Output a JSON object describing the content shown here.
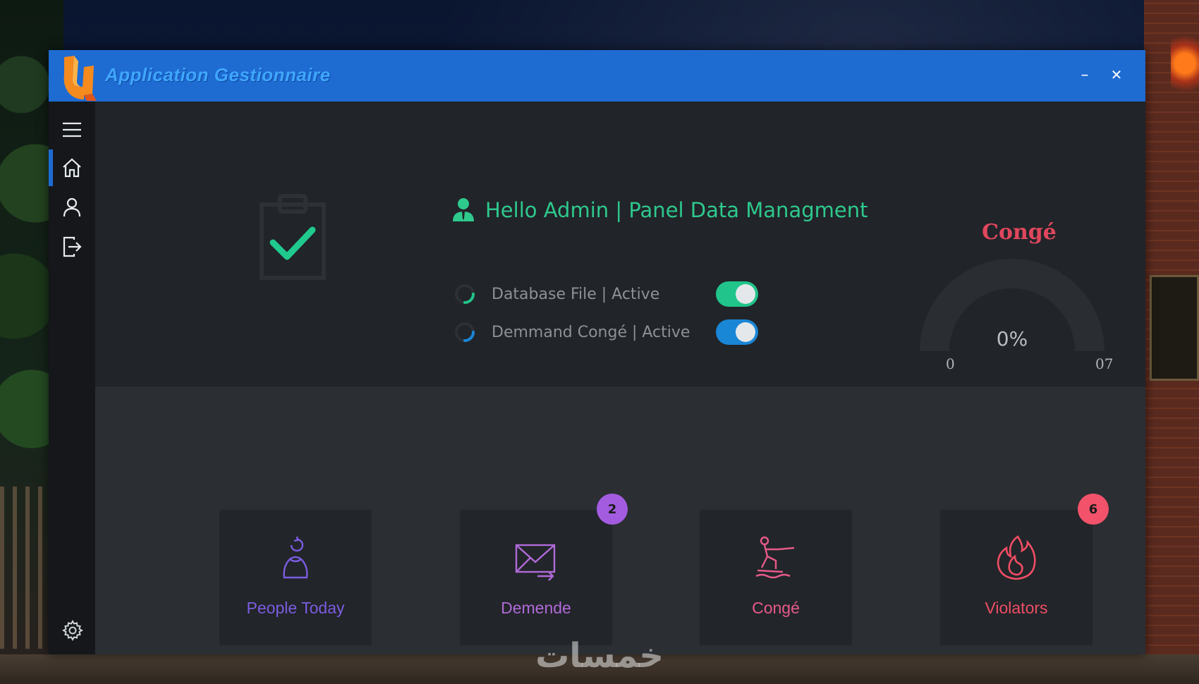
{
  "window": {
    "title": "Application Gestionnaire",
    "minimize_label": "–",
    "close_label": "✕",
    "title_bar_color": "#1e6bd2"
  },
  "sidebar": {
    "items": [
      {
        "icon": "hamburger-menu-icon"
      },
      {
        "icon": "home-icon",
        "active": true
      },
      {
        "icon": "user-icon"
      },
      {
        "icon": "logout-icon"
      }
    ],
    "footer_icon": "settings-gear-icon"
  },
  "header": {
    "greeting": "Hello Admin | Panel Data Managment",
    "greeting_color": "#2ec98d"
  },
  "status": [
    {
      "label": "Database File | Active",
      "toggle_on": true,
      "toggle_color": "#21c48a"
    },
    {
      "label": "Demmand Congé | Active",
      "toggle_on": true,
      "toggle_color": "#1a86d6"
    }
  ],
  "gauge": {
    "title": "Congé",
    "value_text": "0%",
    "value_percent": 0,
    "min_label": "0",
    "max_label": "07",
    "title_color": "#e0475d"
  },
  "tiles": [
    {
      "label": "People Today",
      "icon": "person-refresh-icon",
      "color": "#7b5ce0",
      "badge": null
    },
    {
      "label": "Demende",
      "icon": "mail-forward-icon",
      "color": "#b06ad8",
      "badge": "2",
      "badge_color": "#a35ce0"
    },
    {
      "label": "Congé",
      "icon": "water-ski-icon",
      "color": "#e85a8a",
      "badge": null
    },
    {
      "label": "Violators",
      "icon": "flame-icon",
      "color": "#ef4d64",
      "badge": "6",
      "badge_color": "#f2536a"
    }
  ],
  "watermark": "خمسات"
}
